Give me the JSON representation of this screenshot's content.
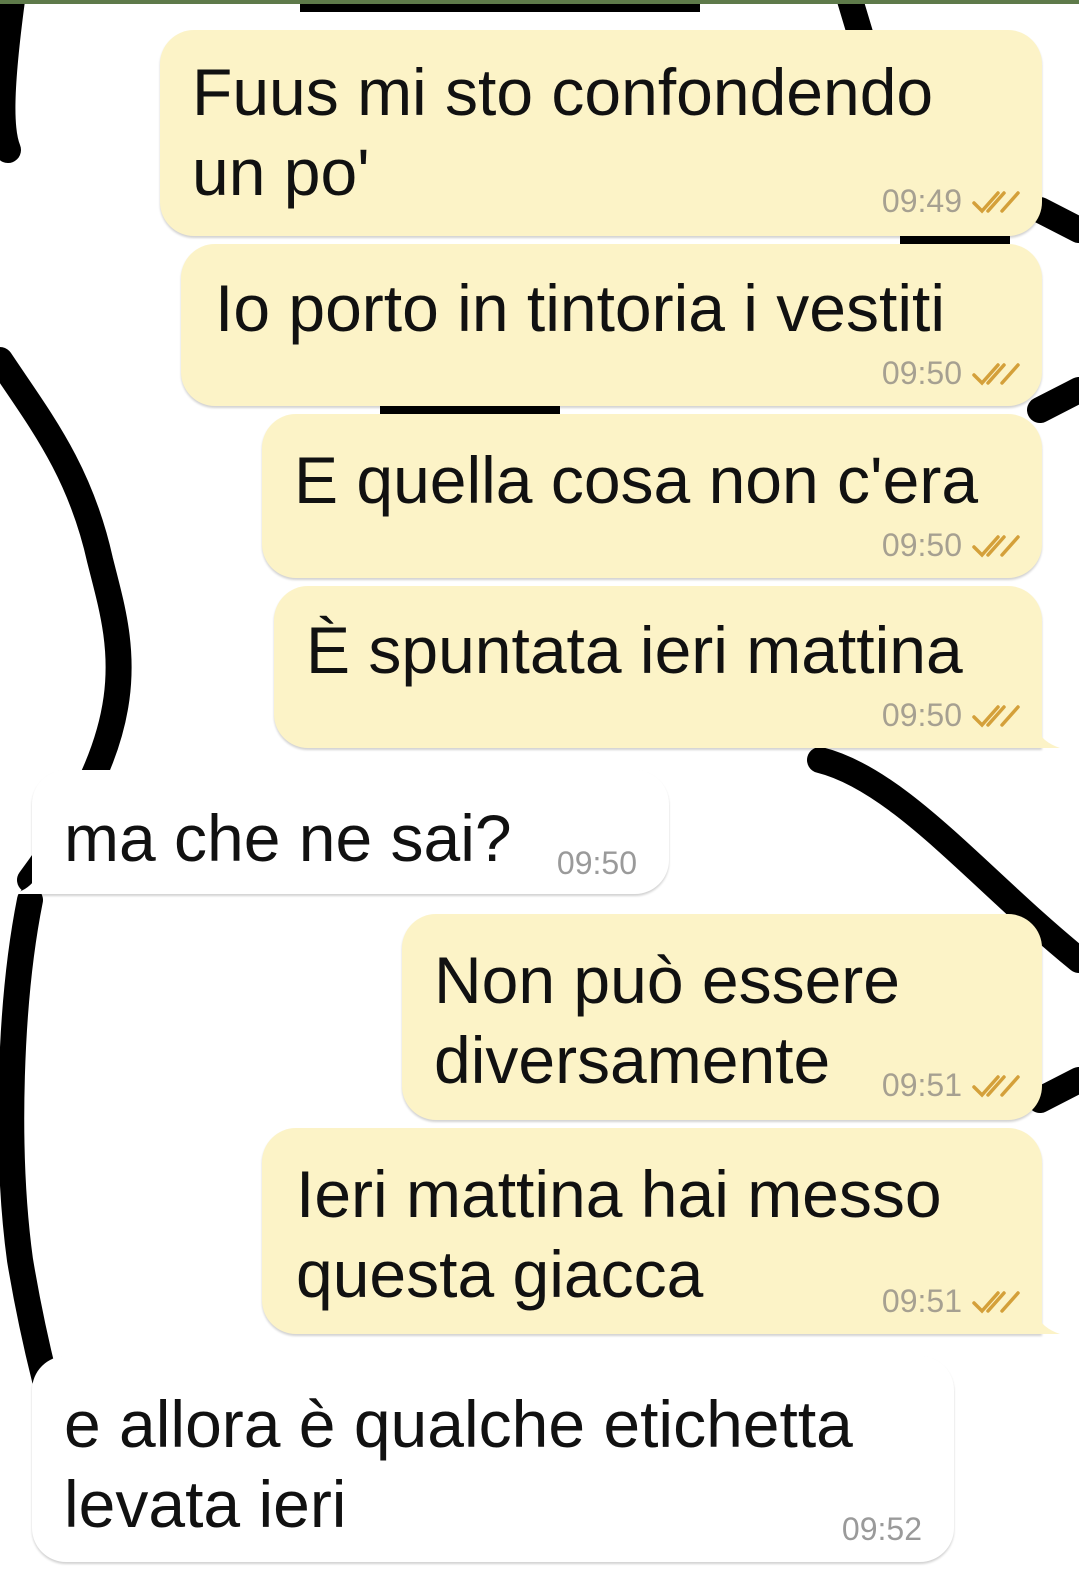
{
  "colors": {
    "outgoing_bubble": "#fcf3c7",
    "incoming_bubble": "#ffffff",
    "ticks": "#d4a03a",
    "time": "#a6a091"
  },
  "messages": [
    {
      "direction": "outgoing",
      "text": "Fuus mi sto confondendo\nun po'",
      "time": "09:49",
      "read": true
    },
    {
      "direction": "outgoing",
      "text": "Io porto in tintoria i vestiti",
      "time": "09:50",
      "read": true
    },
    {
      "direction": "outgoing",
      "text": "E quella cosa non c'era",
      "time": "09:50",
      "read": true
    },
    {
      "direction": "outgoing",
      "text": "È spuntata ieri mattina",
      "time": "09:50",
      "read": true
    },
    {
      "direction": "incoming",
      "text": "ma che ne sai?",
      "time": "09:50"
    },
    {
      "direction": "outgoing",
      "text": "Non può essere\ndiversamente",
      "time": "09:51",
      "read": true
    },
    {
      "direction": "outgoing",
      "text": "Ieri mattina hai messo\nquesta giacca",
      "time": "09:51",
      "read": true
    },
    {
      "direction": "incoming",
      "text": "e allora è qualche etichetta\nlevata ieri",
      "time": "09:52"
    }
  ]
}
